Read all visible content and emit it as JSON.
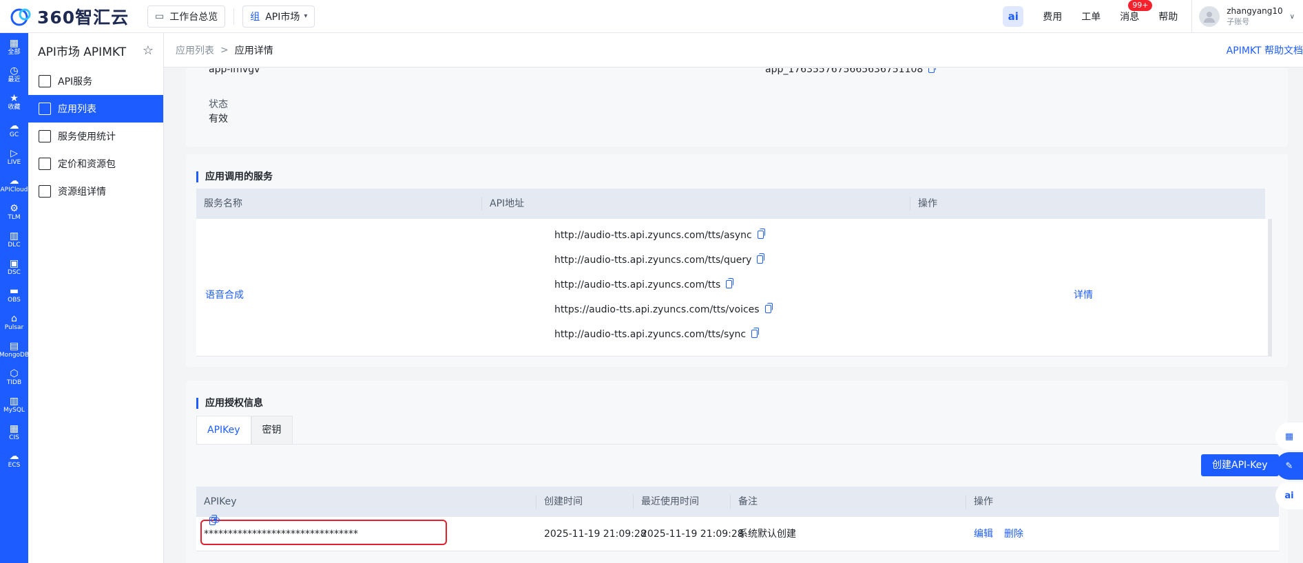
{
  "brand": {
    "logo_text": "360智汇云",
    "accent": "#1d5cff"
  },
  "topbar": {
    "overview": "工作台总览",
    "market_prefix": "组",
    "market": "API市场",
    "ai_label": "ai",
    "links": [
      "费用",
      "工单",
      "消息",
      "帮助"
    ],
    "message_badge": "99+",
    "user_name": "zhangyang10",
    "user_role": "子账号"
  },
  "rail": [
    {
      "icon": "grid-icon",
      "label": "全部"
    },
    {
      "icon": "clock-icon",
      "label": "最近"
    },
    {
      "icon": "star-icon",
      "label": "收藏"
    },
    {
      "icon": "cloud-icon",
      "label": "GC"
    },
    {
      "icon": "play-icon",
      "label": "LIVE"
    },
    {
      "icon": "cloud-icon",
      "label": "APICloud"
    },
    {
      "icon": "gear-icon",
      "label": "TLM"
    },
    {
      "icon": "box-icon",
      "label": "DLC"
    },
    {
      "icon": "box-icon",
      "label": "DSC"
    },
    {
      "icon": "disk-icon",
      "label": "OBS"
    },
    {
      "icon": "house-icon",
      "label": "Pulsar"
    },
    {
      "icon": "chart-icon",
      "label": "MongoDB"
    },
    {
      "icon": "hex-icon",
      "label": "TIDB"
    },
    {
      "icon": "db-icon",
      "label": "MySQL"
    },
    {
      "icon": "grid-icon",
      "label": "CIS"
    },
    {
      "icon": "cloud-icon",
      "label": "ECS"
    }
  ],
  "subnav": {
    "title": "API市场 APIMKT",
    "items": [
      "API服务",
      "应用列表",
      "服务使用统计",
      "定价和资源包",
      "资源组详情"
    ]
  },
  "breadcrumb": {
    "parent": "应用列表",
    "sep": ">",
    "current": "应用详情",
    "help": "APIMKT 帮助文档"
  },
  "app_info": {
    "app_name": "app-imvgv",
    "app_id": "app_1763557675665636751108",
    "status_label": "状态",
    "status_value": "有效"
  },
  "services": {
    "title": "应用调用的服务",
    "headers": [
      "服务名称",
      "API地址",
      "操作"
    ],
    "name": "语音合成",
    "urls": [
      "http://audio-tts.api.zyuncs.com/tts/async",
      "http://audio-tts.api.zyuncs.com/tts/query",
      "http://audio-tts.api.zyuncs.com/tts",
      "https://audio-tts.api.zyuncs.com/tts/voices",
      "http://audio-tts.api.zyuncs.com/tts/sync"
    ],
    "op": "详情"
  },
  "auth": {
    "title": "应用授权信息",
    "tabs": [
      "APIKey",
      "密钥"
    ],
    "create": "创建API-Key",
    "headers": [
      "APIKey",
      "创建时间",
      "最近使用时间",
      "备注",
      "操作"
    ],
    "row": {
      "key": "********************************",
      "created": "2025-11-19 21:09:28",
      "last_used": "2025-11-19 21:09:28",
      "note": "系统默认创建",
      "edit": "编辑",
      "delete": "删除"
    }
  },
  "float_buttons": [
    "qr-icon",
    "edit-icon",
    "ai"
  ]
}
